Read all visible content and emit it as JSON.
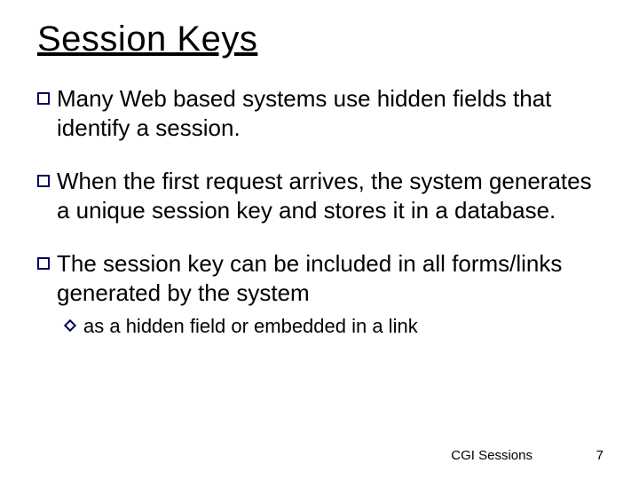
{
  "slide": {
    "title": "Session Keys",
    "bullets": [
      {
        "text": "Many Web based systems use hidden fields that identify a session."
      },
      {
        "text": "When the first request arrives, the system generates a unique session key and stores it in a database."
      },
      {
        "text": "The session key can be included in all forms/links generated by the system",
        "sub": [
          {
            "text": "as a hidden field or embedded in a link"
          }
        ]
      }
    ],
    "footer_topic": "CGI Sessions",
    "page_number": "7"
  }
}
